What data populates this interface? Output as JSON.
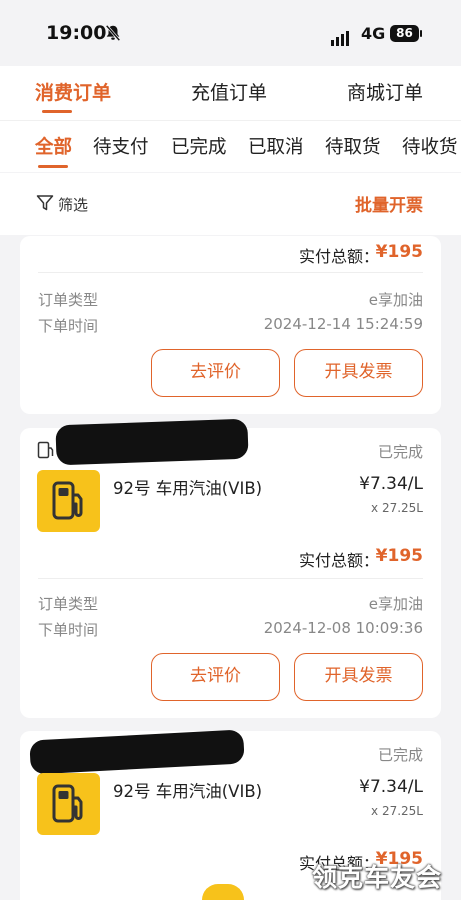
{
  "status_bar": {
    "time": "19:00",
    "network": "4G",
    "battery": "86"
  },
  "top_tabs": [
    "消费订单",
    "充值订单",
    "商城订单"
  ],
  "status_tabs": [
    "全部",
    "待支付",
    "已完成",
    "已取消",
    "待取货",
    "待收货"
  ],
  "filter": {
    "label": "筛选",
    "batch_invoice": "批量开票"
  },
  "orders": [
    {
      "total_label": "实付总额：",
      "total": "¥195",
      "order_type_label": "订单类型",
      "order_type": "e享加油",
      "order_time_label": "下单时间",
      "order_time": "2024-12-14 15:24:59",
      "review_btn": "去评价",
      "invoice_btn": "开具发票"
    },
    {
      "status": "已完成",
      "product": "92号 车用汽油(VIB)",
      "unit_price": "¥7.34/L",
      "quantity": "x 27.25L",
      "total_label": "实付总额：",
      "total": "¥195",
      "order_type_label": "订单类型",
      "order_type": "e享加油",
      "order_time_label": "下单时间",
      "order_time": "2024-12-08 10:09:36",
      "review_btn": "去评价",
      "invoice_btn": "开具发票"
    },
    {
      "status": "已完成",
      "product": "92号 车用汽油(VIB)",
      "unit_price": "¥7.34/L",
      "quantity": "x 27.25L",
      "total_label": "实付总额：",
      "total": "¥195"
    }
  ],
  "watermark": "领克车友会",
  "colors": {
    "accent": "#e0642b",
    "fuel_thumb": "#f7c21b",
    "background": "#f3f3f5"
  }
}
